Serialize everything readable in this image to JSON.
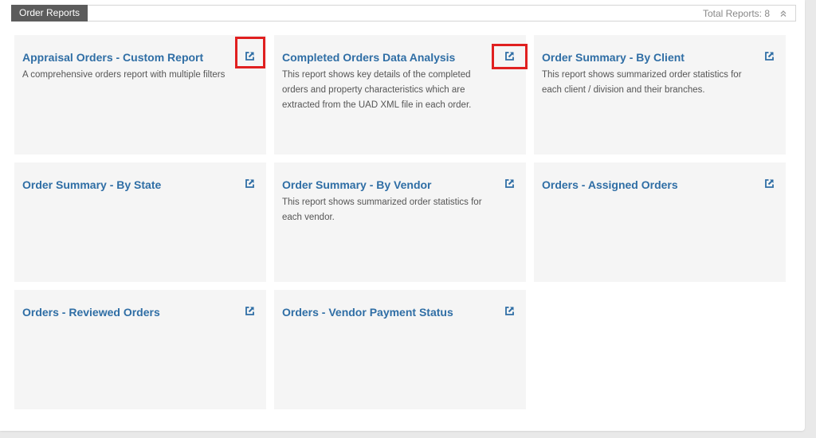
{
  "header": {
    "tab_label": "Order Reports",
    "total_label": "Total Reports: 8"
  },
  "cards": [
    {
      "title": "Appraisal Orders - Custom Report",
      "description": "A comprehensive orders report with multiple filters"
    },
    {
      "title": "Completed Orders Data Analysis",
      "description": "This report shows key details of the completed orders and property characteristics which are extracted from the UAD XML file in each order."
    },
    {
      "title": "Order Summary - By Client",
      "description": "This report shows summarized order statistics for each client / division and their branches."
    },
    {
      "title": "Order Summary - By State",
      "description": ""
    },
    {
      "title": "Order Summary - By Vendor",
      "description": "This report shows summarized order statistics for each vendor."
    },
    {
      "title": "Orders - Assigned Orders",
      "description": ""
    },
    {
      "title": "Orders - Reviewed Orders",
      "description": ""
    },
    {
      "title": "Orders - Vendor Payment Status",
      "description": ""
    }
  ],
  "icons": {
    "external_link": "external-link-icon",
    "collapse": "chevron-double-up-icon"
  },
  "colors": {
    "link": "#2f6ea5",
    "card_bg": "#f5f5f5",
    "tab_bg": "#5c5c5c",
    "highlight": "#e02020"
  }
}
